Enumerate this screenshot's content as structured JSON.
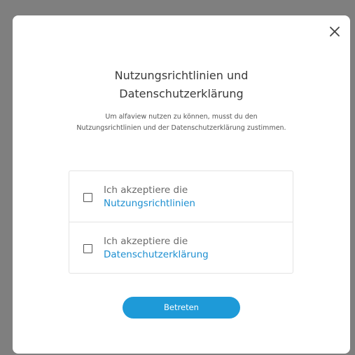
{
  "dialog": {
    "title_line1": "Nutzungsrichtlinien und",
    "title_line2": "Datenschutzerklärung",
    "description": "Um alfaview nutzen zu können, musst du den Nutzungsrichtlinien und der Datenschutzerklärung zustimmen.",
    "close_icon": "close-icon"
  },
  "consents": [
    {
      "prefix": "Ich akzeptiere die",
      "link": "Nutzungsrichtlinien",
      "checked": false
    },
    {
      "prefix": "Ich akzeptiere die",
      "link": "Datenschutzerklärung",
      "checked": false
    }
  ],
  "actions": {
    "enter_label": "Betreten"
  },
  "colors": {
    "accent": "#1e9ad8",
    "link": "#1b8ed0",
    "backdrop": "#7f7f7f"
  }
}
